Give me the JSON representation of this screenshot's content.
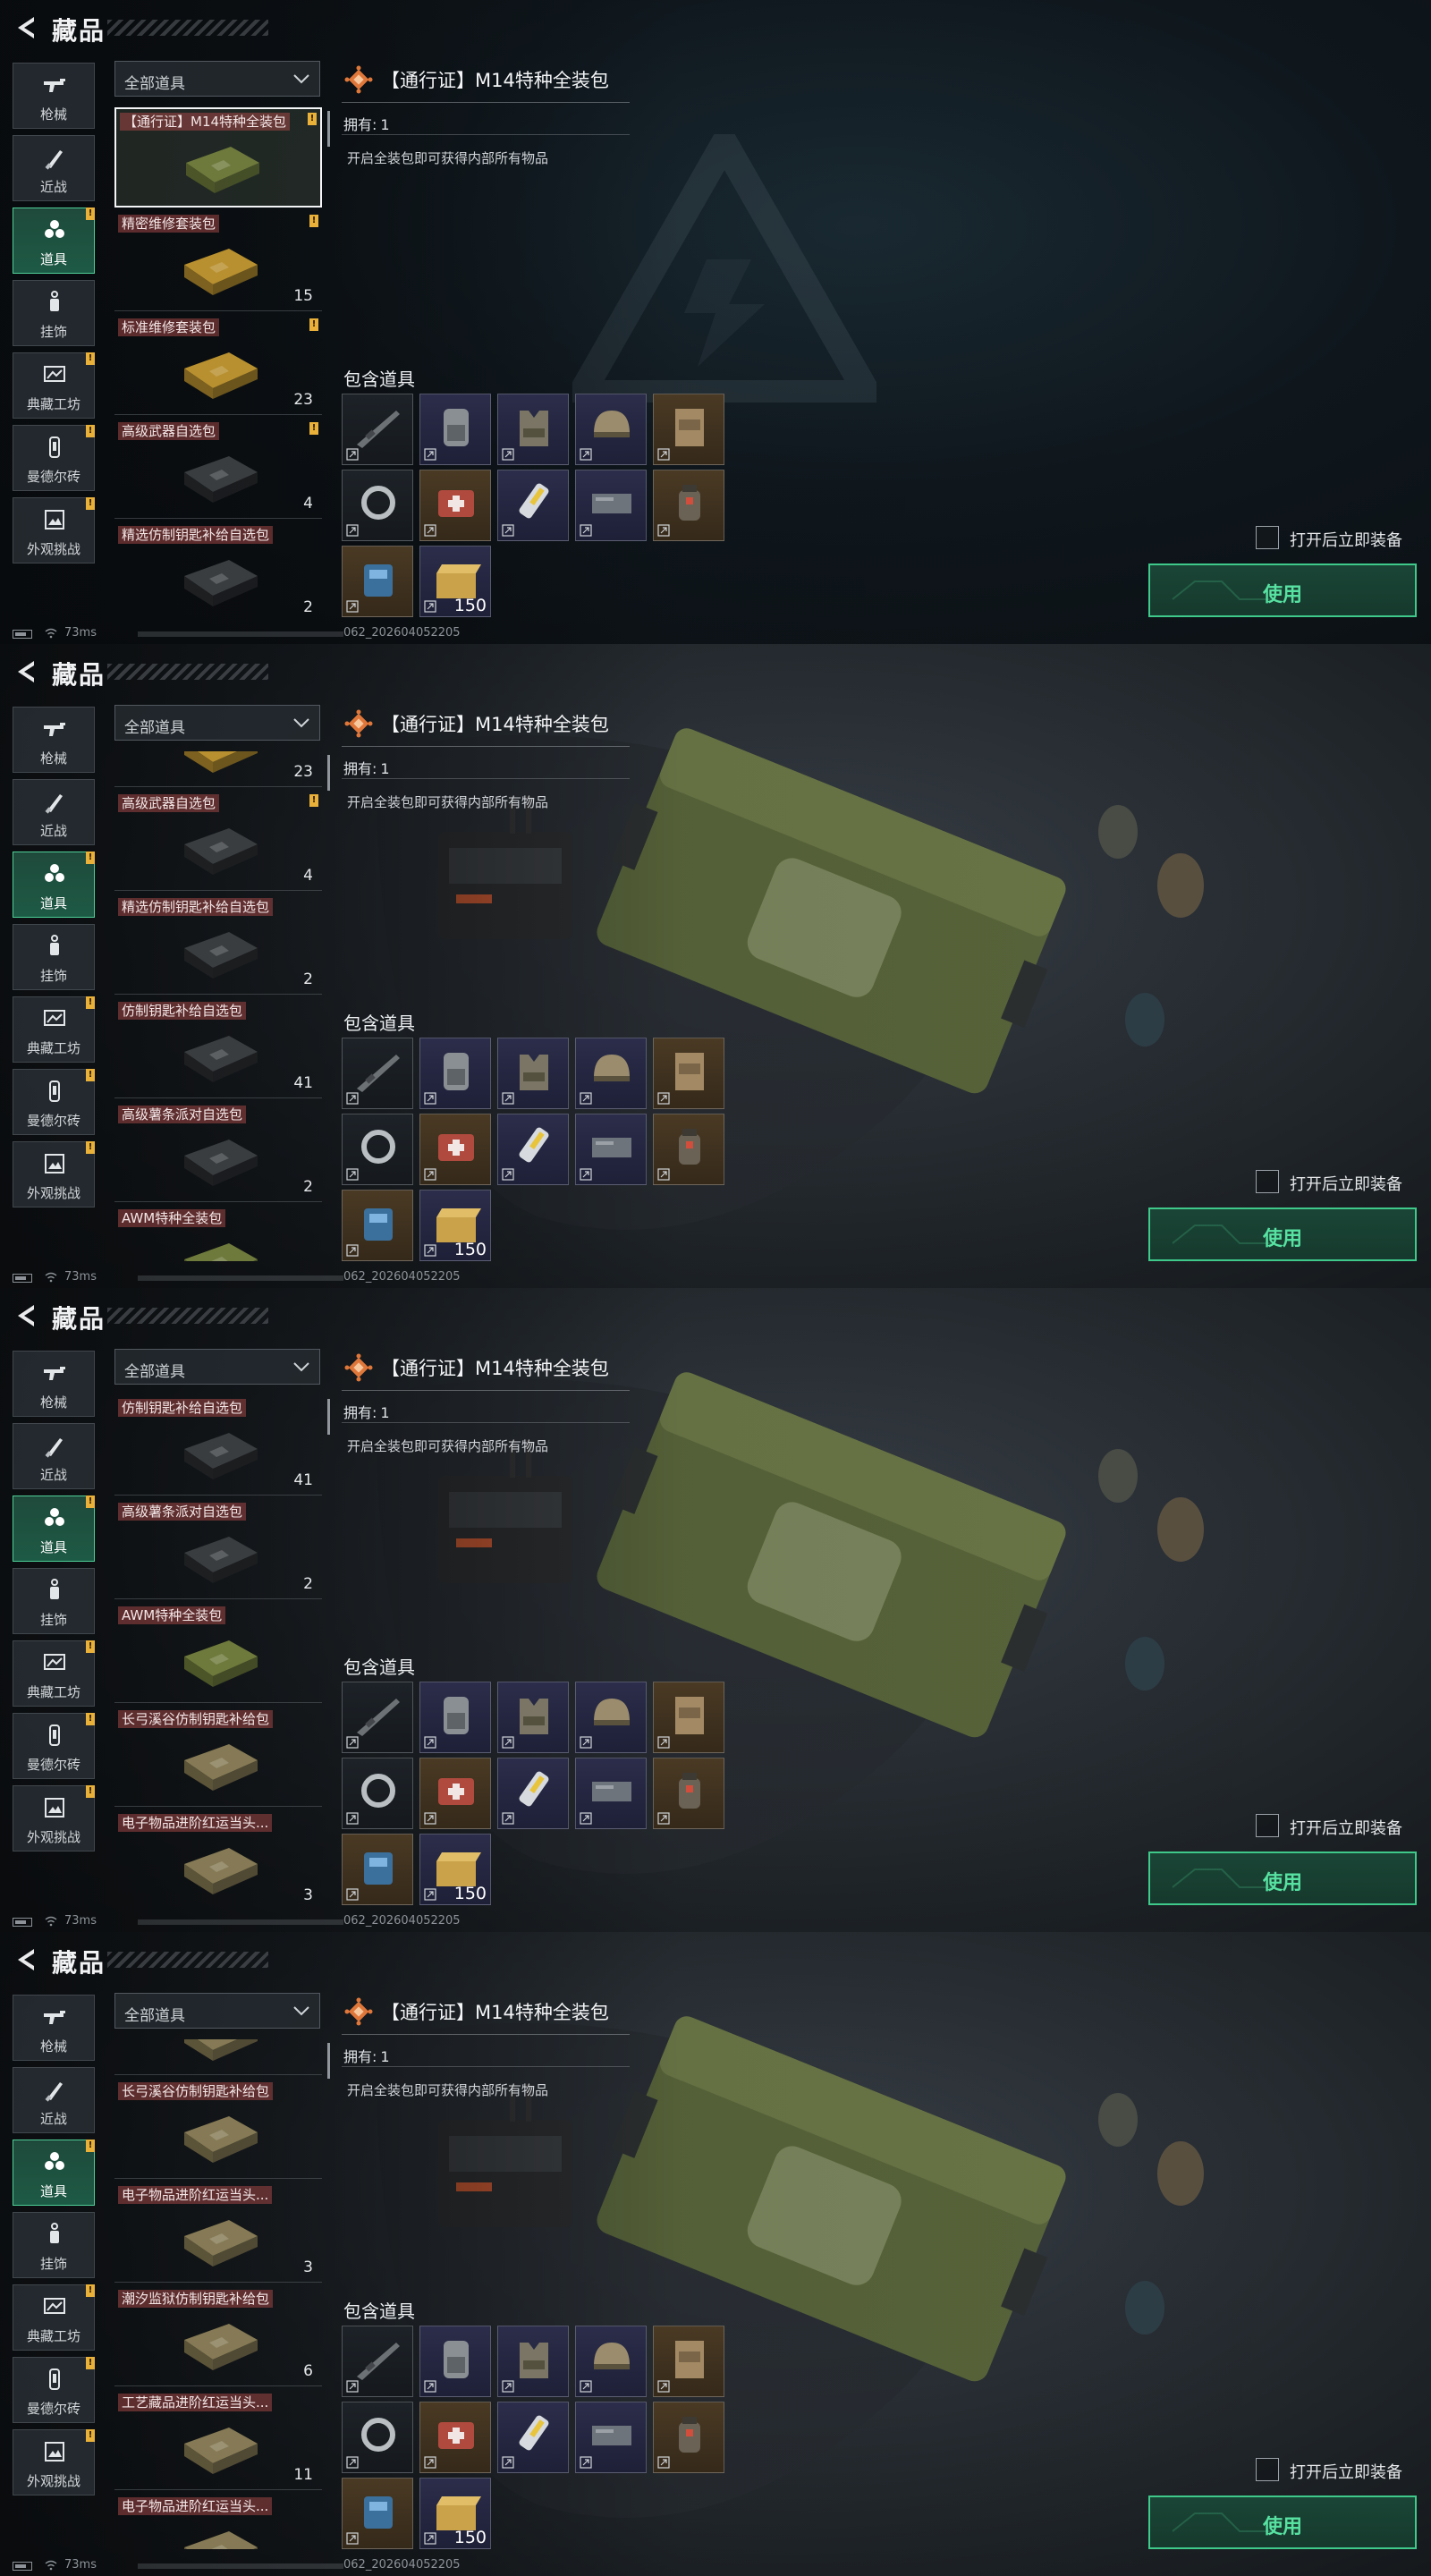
{
  "header": {
    "title": "藏品"
  },
  "categories": [
    {
      "label": "枪械",
      "icon": "rifle-icon",
      "badge": false,
      "active": false
    },
    {
      "label": "近战",
      "icon": "knife-icon",
      "badge": false,
      "active": false
    },
    {
      "label": "道具",
      "icon": "cluster-icon",
      "badge": true,
      "active": true
    },
    {
      "label": "挂饰",
      "icon": "charm-icon",
      "badge": false,
      "active": false
    },
    {
      "label": "典藏工坊",
      "icon": "frame-icon",
      "badge": true,
      "active": false
    },
    {
      "label": "曼德尔砖",
      "icon": "brick-icon",
      "badge": true,
      "active": false
    },
    {
      "label": "外观挑战",
      "icon": "picture-icon",
      "badge": true,
      "active": false
    }
  ],
  "filter": {
    "label": "全部道具"
  },
  "detail": {
    "title": "【通行证】M14特种全装包",
    "owned_label": "拥有:",
    "owned_value": "1",
    "description": "开启全装包即可获得内部所有物品",
    "contains_label": "包含道具",
    "auto_equip_label": "打开后立即装备",
    "use_label": "使用",
    "contents": [
      {
        "art": "rifle",
        "tone": "dark",
        "count": ""
      },
      {
        "art": "backpack",
        "tone": "purple",
        "count": ""
      },
      {
        "art": "vest",
        "tone": "purple",
        "count": ""
      },
      {
        "art": "helmet",
        "tone": "purple",
        "count": ""
      },
      {
        "art": "plate-carrier",
        "tone": "gold",
        "count": ""
      },
      {
        "art": "ring",
        "tone": "dark",
        "count": ""
      },
      {
        "art": "medkit",
        "tone": "gold",
        "count": ""
      },
      {
        "art": "syringe",
        "tone": "purple",
        "count": ""
      },
      {
        "art": "plate",
        "tone": "purple",
        "count": ""
      },
      {
        "art": "grenade",
        "tone": "gold",
        "count": ""
      },
      {
        "art": "battery",
        "tone": "gold",
        "count": ""
      },
      {
        "art": "ammo-box",
        "tone": "purple",
        "count": "150"
      }
    ]
  },
  "status": {
    "ping": "73ms",
    "session": "062_202604052205"
  },
  "frames": [
    {
      "background": "plain",
      "list": [
        {
          "name": "【通行证】M14特种全装包",
          "count": "",
          "badge": true,
          "selected": true,
          "color": "olive"
        },
        {
          "name": "精密维修套装包",
          "count": "15",
          "badge": true,
          "selected": false,
          "color": "gold"
        },
        {
          "name": "标准维修套装包",
          "count": "23",
          "badge": true,
          "selected": false,
          "color": "gold"
        },
        {
          "name": "高级武器自选包",
          "count": "4",
          "badge": true,
          "selected": false,
          "color": "black"
        },
        {
          "name": "精选仿制钥匙补给自选包",
          "count": "2",
          "badge": false,
          "selected": false,
          "color": "black"
        }
      ]
    },
    {
      "background": "scene",
      "list": [
        {
          "name": "",
          "count": "23",
          "badge": false,
          "selected": false,
          "color": "gold-partial"
        },
        {
          "name": "高级武器自选包",
          "count": "4",
          "badge": true,
          "selected": false,
          "color": "black"
        },
        {
          "name": "精选仿制钥匙补给自选包",
          "count": "2",
          "badge": false,
          "selected": false,
          "color": "black"
        },
        {
          "name": "仿制钥匙补给自选包",
          "count": "41",
          "badge": false,
          "selected": false,
          "color": "black"
        },
        {
          "name": "高级薯条派对自选包",
          "count": "2",
          "badge": false,
          "selected": false,
          "color": "black"
        },
        {
          "name": "AWM特种全装包",
          "count": "",
          "badge": false,
          "selected": false,
          "color": "olive"
        }
      ]
    },
    {
      "background": "scene",
      "list": [
        {
          "name": "仿制钥匙补给自选包",
          "count": "41",
          "badge": false,
          "selected": false,
          "color": "black"
        },
        {
          "name": "高级薯条派对自选包",
          "count": "2",
          "badge": false,
          "selected": false,
          "color": "black"
        },
        {
          "name": "AWM特种全装包",
          "count": "",
          "badge": false,
          "selected": false,
          "color": "olive"
        },
        {
          "name": "长弓溪谷仿制钥匙补给包",
          "count": "",
          "badge": false,
          "selected": false,
          "color": "tan"
        },
        {
          "name": "电子物品进阶红运当头...",
          "count": "3",
          "badge": false,
          "selected": false,
          "color": "tan"
        }
      ]
    },
    {
      "background": "scene",
      "list": [
        {
          "name": "",
          "count": "",
          "badge": false,
          "selected": false,
          "color": "tan-partial"
        },
        {
          "name": "长弓溪谷仿制钥匙补给包",
          "count": "",
          "badge": false,
          "selected": false,
          "color": "tan"
        },
        {
          "name": "电子物品进阶红运当头...",
          "count": "3",
          "badge": false,
          "selected": false,
          "color": "tan"
        },
        {
          "name": "潮汐监狱仿制钥匙补给包",
          "count": "6",
          "badge": false,
          "selected": false,
          "color": "tan"
        },
        {
          "name": "工艺藏品进阶红运当头...",
          "count": "11",
          "badge": false,
          "selected": false,
          "color": "tan"
        },
        {
          "name": "电子物品进阶红运当头...",
          "count": "",
          "badge": false,
          "selected": false,
          "color": "tan"
        }
      ]
    }
  ],
  "colors": {
    "accent": "#3fc98b",
    "accent_text": "#57e2a2",
    "badge": "#e9b13a",
    "label_red": "#a04646"
  }
}
